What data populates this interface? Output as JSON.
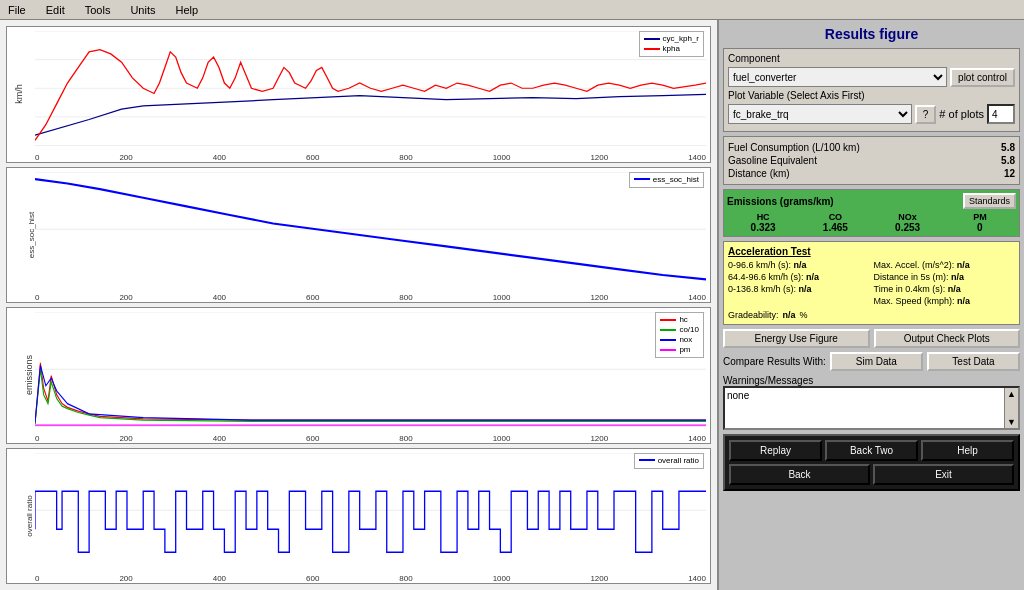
{
  "menubar": {
    "items": [
      "File",
      "Edit",
      "Tools",
      "Units",
      "Help"
    ]
  },
  "right_panel": {
    "title": "Results figure",
    "component": {
      "label": "Component",
      "value": "fuel_converter",
      "options": [
        "fuel_converter"
      ]
    },
    "plot_control_btn": "plot control",
    "plot_variable": {
      "label": "Plot Variable (Select Axis First)",
      "value": "fc_brake_trq",
      "options": [
        "fc_brake_trq"
      ]
    },
    "question_btn": "?",
    "nplots_label": "# of plots",
    "nplots_value": "4",
    "fuel_consumption": {
      "label": "Fuel Consumption (L/100 km)",
      "value": "5.8"
    },
    "gasoline_equiv": {
      "label": "Gasoline Equivalent",
      "value": "5.8"
    },
    "distance": {
      "label": "Distance (km)",
      "value": "12"
    },
    "emissions": {
      "label": "Emissions (grams/km)",
      "standards_btn": "Standards",
      "cols": [
        {
          "label": "HC",
          "value": "0.323"
        },
        {
          "label": "CO",
          "value": "1.465"
        },
        {
          "label": "NOx",
          "value": "0.253"
        },
        {
          "label": "PM",
          "value": "0"
        }
      ]
    },
    "accel": {
      "title": "Acceleration Test",
      "rows": [
        {
          "label": "0-96.6 km/h (s):",
          "value": "n/a",
          "label2": "Max. Accel. (m/s^2):",
          "value2": "n/a"
        },
        {
          "label": "64.4-96.6 km/h (s):",
          "value": "n/a",
          "label2": "Distance in 5s (m):",
          "value2": "n/a"
        },
        {
          "label": "0-136.8 km/h (s):",
          "value": "n/a",
          "label2": "Time in 0.4km (s):",
          "value2": "n/a"
        },
        {
          "label": "",
          "value": "",
          "label2": "Max. Speed (kmph):",
          "value2": "n/a"
        }
      ],
      "gradeability_label": "Gradeability:",
      "gradeability_value": "n/a",
      "gradeability_unit": "%"
    },
    "energy_figure_btn": "Energy Use Figure",
    "output_check_btn": "Output Check Plots",
    "compare_label": "Compare Results With:",
    "sim_data_btn": "Sim Data",
    "test_data_btn": "Test Data",
    "warnings_label": "Warnings/Messages",
    "warnings_text": "none",
    "replay_btn": "Replay",
    "back_two_btn": "Back Two",
    "help_btn": "Help",
    "back_btn": "Back",
    "exit_btn": "Exit"
  },
  "charts": [
    {
      "id": "speed",
      "ylabel": "km/h",
      "ymax": 100,
      "legend": [
        {
          "label": "cyc_kph_r",
          "color": "#00008B"
        },
        {
          "label": "kpha",
          "color": "#FF0000"
        }
      ]
    },
    {
      "id": "soc",
      "ylabel": "ess_soc_hist",
      "ymin": 0.62,
      "ymax": 0.7,
      "legend": [
        {
          "label": "ess_soc_hist",
          "color": "#0000FF"
        }
      ]
    },
    {
      "id": "emissions",
      "ylabel": "emissions",
      "ymax": 0.2,
      "legend": [
        {
          "label": "hc",
          "color": "#FF0000"
        },
        {
          "label": "co/10",
          "color": "#00AA00"
        },
        {
          "label": "nox",
          "color": "#0000FF"
        },
        {
          "label": "pm",
          "color": "#FF00FF"
        }
      ]
    },
    {
      "id": "ratio",
      "ylabel": "overall ratio",
      "ymax": 15,
      "legend": [
        {
          "label": "overall ratio",
          "color": "#0000FF"
        }
      ]
    }
  ],
  "xaxis_labels": [
    "0",
    "200",
    "400",
    "600",
    "800",
    "1000",
    "1200",
    "1400"
  ]
}
